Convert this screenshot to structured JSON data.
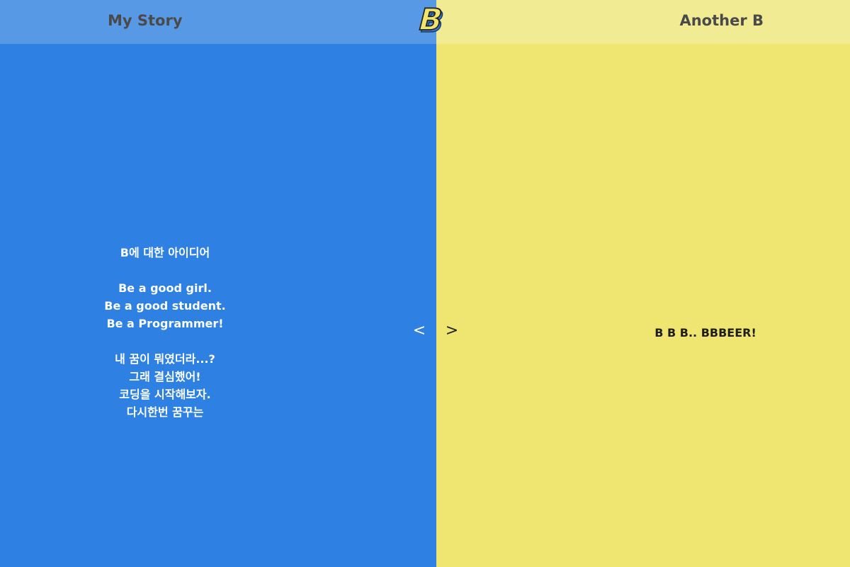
{
  "colors": {
    "left_panel": "#2e80e2",
    "left_topbar": "#5899e6",
    "right_panel": "#efe672",
    "right_topbar": "#f1ec93",
    "nav_text": "#4a4a4a",
    "story_text": "#ffffff",
    "right_text": "#1e1e1e"
  },
  "header": {
    "left_link": "My Story",
    "right_link": "Another B",
    "logo_icon": "b-logo-icon",
    "logo_text": "B"
  },
  "left": {
    "story_lines": [
      "B에 대한 아이디어",
      "",
      "Be a good girl.",
      "Be a good student.",
      "Be a Programmer!",
      "",
      "내 꿈이 뭐였더라...?",
      "그래 결심했어!",
      "코딩을 시작해보자.",
      "다시한번 꿈꾸는"
    ]
  },
  "nav": {
    "prev_label": "<",
    "next_label": ">",
    "prev_icon": "chevron-left-icon",
    "next_icon": "chevron-right-icon"
  },
  "right": {
    "text": "B B B.. BBBEER!"
  }
}
